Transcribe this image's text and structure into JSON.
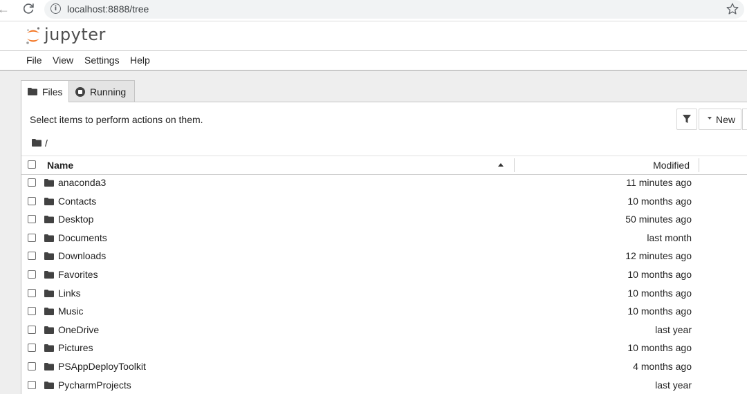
{
  "browser": {
    "url": "localhost:8888/tree",
    "back_icon": "arrow-left-icon",
    "reload_icon": "reload-icon",
    "info_icon": "info-icon",
    "star_icon": "star-icon"
  },
  "app": {
    "brand": "jupyter",
    "brand_color": "#f37726"
  },
  "menubar": {
    "items": [
      "File",
      "View",
      "Settings",
      "Help"
    ]
  },
  "tabs": [
    {
      "label": "Files",
      "icon": "folder-icon",
      "active": true
    },
    {
      "label": "Running",
      "icon": "stop-circle-icon",
      "active": false
    }
  ],
  "filebrowser": {
    "hint": "Select items to perform actions on them.",
    "filter_icon": "filter-icon",
    "new_label": "New",
    "breadcrumb_separator": "/",
    "columns": {
      "name": "Name",
      "modified": "Modified"
    },
    "sort": "ascending",
    "files": [
      {
        "name": "anaconda3",
        "modified": "11 minutes ago"
      },
      {
        "name": "Contacts",
        "modified": "10 months ago"
      },
      {
        "name": "Desktop",
        "modified": "50 minutes ago"
      },
      {
        "name": "Documents",
        "modified": "last month"
      },
      {
        "name": "Downloads",
        "modified": "12 minutes ago"
      },
      {
        "name": "Favorites",
        "modified": "10 months ago"
      },
      {
        "name": "Links",
        "modified": "10 months ago"
      },
      {
        "name": "Music",
        "modified": "10 months ago"
      },
      {
        "name": "OneDrive",
        "modified": "last year"
      },
      {
        "name": "Pictures",
        "modified": "10 months ago"
      },
      {
        "name": "PSAppDeployToolkit",
        "modified": "4 months ago"
      },
      {
        "name": "PycharmProjects",
        "modified": "last year"
      }
    ]
  }
}
